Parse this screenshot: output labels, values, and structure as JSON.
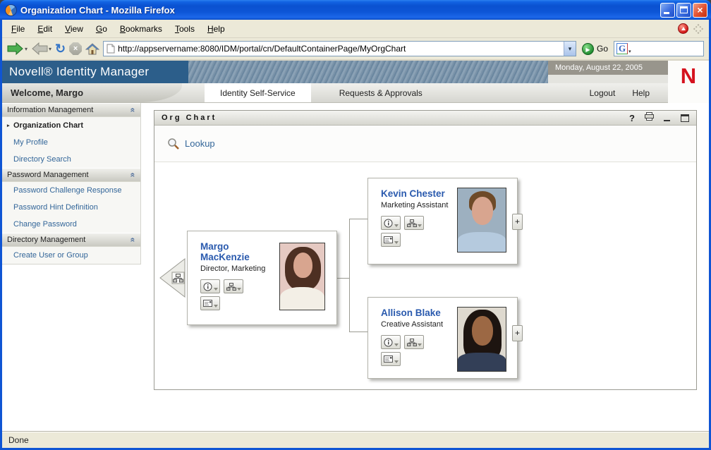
{
  "window": {
    "title": "Organization Chart - Mozilla Firefox",
    "status": "Done"
  },
  "menubar": {
    "items": [
      "File",
      "Edit",
      "View",
      "Go",
      "Bookmarks",
      "Tools",
      "Help"
    ]
  },
  "navbar": {
    "url": "http://appservername:8080/IDM/portal/cn/DefaultContainerPage/MyOrgChart",
    "go_label": "Go",
    "search_engine": "Google"
  },
  "header": {
    "product": "Novell® Identity Manager",
    "date": "Monday, August 22, 2005",
    "welcome": "Welcome, Margo",
    "logout": "Logout",
    "help": "Help",
    "novell_logo": "N"
  },
  "tabs": [
    {
      "label": "Identity Self-Service",
      "active": true
    },
    {
      "label": "Requests & Approvals",
      "active": false
    }
  ],
  "sidebar": {
    "sections": [
      {
        "title": "Information Management",
        "items": [
          {
            "label": "Organization Chart",
            "selected": true
          },
          {
            "label": "My Profile",
            "selected": false
          },
          {
            "label": "Directory Search",
            "selected": false
          }
        ]
      },
      {
        "title": "Password Management",
        "items": [
          {
            "label": "Password Challenge Response",
            "selected": false
          },
          {
            "label": "Password Hint Definition",
            "selected": false
          },
          {
            "label": "Change Password",
            "selected": false
          }
        ]
      },
      {
        "title": "Directory Management",
        "items": [
          {
            "label": "Create User or Group",
            "selected": false
          }
        ]
      }
    ]
  },
  "portlet": {
    "title": "Org Chart",
    "lookup_label": "Lookup"
  },
  "org_chart": {
    "manager": {
      "name": "Margo MacKenzie",
      "title": "Director, Marketing"
    },
    "reports": [
      {
        "name": "Kevin Chester",
        "title": "Marketing Assistant",
        "expand_glyph": "+"
      },
      {
        "name": "Allison Blake",
        "title": "Creative Assistant",
        "expand_glyph": "+"
      }
    ]
  },
  "icons": {
    "close_glyph": "×",
    "stop_glyph": "×",
    "reload_glyph": "↻",
    "dropdown_caret": "▾",
    "back_caret": "▾",
    "go_arrow": "▶",
    "search_engine_glyph": "G",
    "collapse_chevron": "«",
    "selected_bullet": "▸",
    "portlet_help_glyph": "?"
  },
  "colors": {
    "xp_title_blue": "#0f55d4",
    "header_blue": "#2c5e8a",
    "link_blue": "#336699",
    "name_blue": "#2a5aae",
    "novell_red": "#d5121e",
    "toolbar_tan": "#ece9d8"
  }
}
